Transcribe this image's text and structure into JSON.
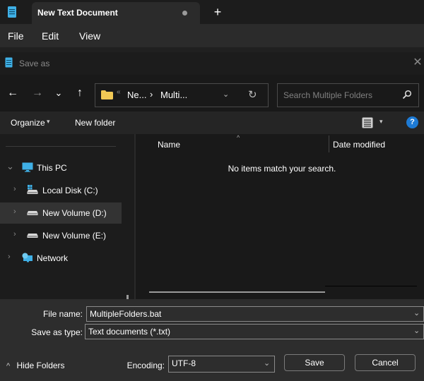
{
  "app": {
    "tab_title": "New Text Document",
    "tab_modified_indicator": "unsaved-dot",
    "new_tab_label": "+",
    "menu": [
      "File",
      "Edit",
      "View"
    ]
  },
  "dialog": {
    "title": "Save as",
    "close_label": "✕",
    "nav": {
      "back": "←",
      "forward": "→",
      "recent": "⌄",
      "up": "↑"
    },
    "address": {
      "overflow": "«",
      "segments": [
        "Ne...",
        "Multi..."
      ],
      "separator": "›",
      "dropdown": "⌄",
      "refresh": "↻"
    },
    "search": {
      "placeholder": "Search Multiple Folders"
    },
    "toolbar": {
      "organize": "Organize",
      "caret": "▾",
      "new_folder": "New folder",
      "view_caret": "▾",
      "help": "?"
    },
    "tree": [
      {
        "label": "This PC",
        "expanded": true,
        "icon": "monitor-icon",
        "chevron": "⌄"
      },
      {
        "label": "Local Disk (C:)",
        "icon": "windows-drive-icon",
        "chevron": "›"
      },
      {
        "label": "New Volume (D:)",
        "icon": "drive-icon",
        "chevron": "›",
        "selected": true
      },
      {
        "label": "New Volume (E:)",
        "icon": "drive-icon",
        "chevron": "›"
      },
      {
        "label": "Network",
        "icon": "network-icon",
        "chevron": "›"
      }
    ],
    "file_list": {
      "columns": [
        "Name",
        "Date modified"
      ],
      "sort_indicator": "^",
      "empty_message": "No items match your search."
    },
    "form": {
      "file_name_label": "File name:",
      "file_name_value": "MultipleFolders.bat",
      "save_type_label": "Save as type:",
      "save_type_value": "Text documents (*.txt)",
      "encoding_label": "Encoding:",
      "encoding_value": "UTF-8",
      "combo_chevron": "⌄",
      "hide_folders": "Hide Folders",
      "hide_folders_icon": "^",
      "save_button": "Save",
      "cancel_button": "Cancel"
    }
  },
  "colors": {
    "accent_blue": "#1d7ad4",
    "folder_yellow": "#f2c955",
    "notepad_icon": "#3fb0e6"
  }
}
